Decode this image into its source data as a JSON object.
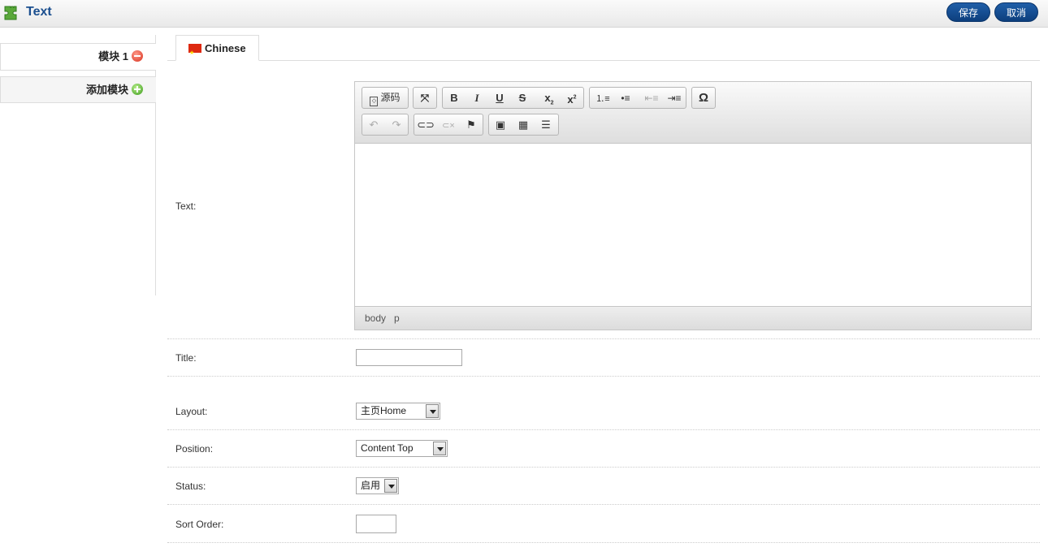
{
  "header": {
    "title": "Text",
    "save_label": "保存",
    "cancel_label": "取消"
  },
  "sidebar": {
    "items": [
      {
        "label": "模块 1",
        "icon": "remove-icon"
      },
      {
        "label": "添加模块",
        "icon": "add-icon"
      }
    ]
  },
  "tabs": [
    {
      "label": "Chinese",
      "icon": "china-flag-icon"
    }
  ],
  "editor": {
    "source_label": "源码",
    "status_path": [
      "body",
      "p"
    ]
  },
  "form": {
    "text_label": "Text:",
    "title_label": "Title:",
    "title_value": "",
    "layout_label": "Layout:",
    "layout_value": "主页Home",
    "position_label": "Position:",
    "position_value": "Content Top",
    "status_label": "Status:",
    "status_value": "启用",
    "sort_order_label": "Sort Order:",
    "sort_order_value": ""
  },
  "colors": {
    "header_title": "#1b4f8f",
    "button_bg": "#14509a",
    "remove_icon": "#d8321f",
    "add_icon": "#3c9a1c"
  }
}
